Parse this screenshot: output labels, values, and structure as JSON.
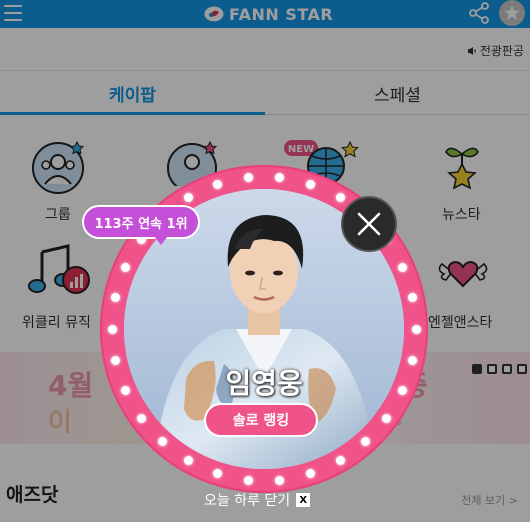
{
  "header": {
    "logo_text": "FANN STAR",
    "menu_icon": "hamburger-menu-icon",
    "share_icon": "share-icon",
    "star_icon": "star-icon",
    "bar_color": "#1496e6"
  },
  "notice": {
    "label": "전광판공"
  },
  "tabs": [
    {
      "label": "케이팝",
      "active": true
    },
    {
      "label": "스페셜",
      "active": false
    }
  ],
  "categories": [
    {
      "label": "그룹",
      "icon": "group-icon"
    },
    {
      "label": "",
      "icon": "solo-icon"
    },
    {
      "label": "",
      "icon": "global-icon",
      "badge": "NEW"
    },
    {
      "label": "뉴스타",
      "icon": "sprout-star-icon"
    },
    {
      "label": "위클리 뮤직",
      "icon": "music-note-icon"
    },
    {
      "label": "엔젤앤스타",
      "icon": "winged-heart-icon"
    }
  ],
  "banner": {
    "line1_left": "4월",
    "line1_right": "중",
    "line2_left": "이",
    "line2_right": "?"
  },
  "ads": {
    "title": "애즈닷",
    "more_label": "전체 보기 >"
  },
  "modal": {
    "rank_badge": "113주 연속 1위",
    "artist_name": "임영웅",
    "solo_button": "솔로 랭킹",
    "close_today": "오늘 하루 닫기",
    "close_today_x": "X",
    "ring_color": "#f0538a",
    "badge_color": "#c44fd9"
  }
}
